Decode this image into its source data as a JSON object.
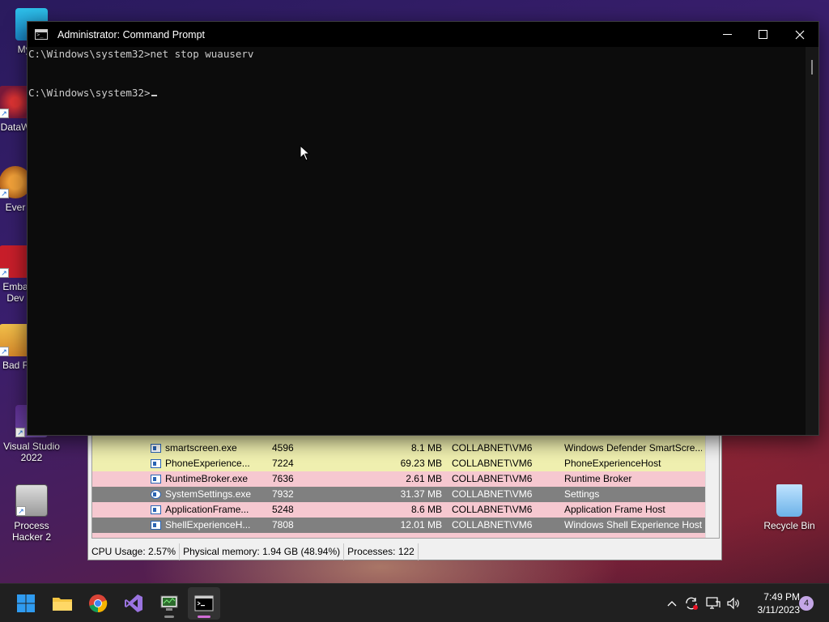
{
  "desktop": {
    "icons": [
      {
        "label": "My Co",
        "name": "my-computer"
      },
      {
        "label": "DataW",
        "name": "datawizard"
      },
      {
        "label": "Ever",
        "name": "everything"
      },
      {
        "label": "Emba\nDev",
        "name": "embarcadero-dev"
      },
      {
        "label": "Bad F",
        "name": "bad-piggies"
      },
      {
        "label": "Visual Studio\n2022",
        "name": "visual-studio-2022"
      },
      {
        "label": "Process\nHacker 2",
        "name": "process-hacker-2"
      },
      {
        "label": "Recycle Bin",
        "name": "recycle-bin"
      }
    ]
  },
  "cmd": {
    "title": "Administrator: Command Prompt",
    "lines": [
      "C:\\Windows\\system32>net stop wuauserv",
      "",
      "C:\\Windows\\system32>"
    ]
  },
  "process_hacker": {
    "rows": [
      {
        "name": "smartscreen.exe",
        "pid": "4596",
        "mem": "8.1 MB",
        "user": "COLLABNET\\VM6",
        "desc": "Windows Defender SmartScre...",
        "color": "#f0f0b0"
      },
      {
        "name": "PhoneExperience...",
        "pid": "7224",
        "mem": "69.23 MB",
        "user": "COLLABNET\\VM6",
        "desc": "PhoneExperienceHost",
        "color": "#f0f0b0"
      },
      {
        "name": "RuntimeBroker.exe",
        "pid": "7636",
        "mem": "2.61 MB",
        "user": "COLLABNET\\VM6",
        "desc": "Runtime Broker",
        "color": "#f6c8d0"
      },
      {
        "name": "SystemSettings.exe",
        "pid": "7932",
        "mem": "31.37 MB",
        "user": "COLLABNET\\VM6",
        "desc": "Settings",
        "color": "#808080"
      },
      {
        "name": "ApplicationFrame...",
        "pid": "5248",
        "mem": "8.6 MB",
        "user": "COLLABNET\\VM6",
        "desc": "Application Frame Host",
        "color": "#f6c8d0"
      },
      {
        "name": "ShellExperienceH...",
        "pid": "7808",
        "mem": "12.01 MB",
        "user": "COLLABNET\\VM6",
        "desc": "Windows Shell Experience Host",
        "color": "#808080"
      }
    ],
    "status": {
      "cpu": "CPU Usage: 2.57%",
      "memory": "Physical memory: 1.94 GB (48.94%)",
      "processes": "Processes: 122"
    }
  },
  "taskbar": {
    "clock_time": "7:49 PM",
    "clock_date": "3/11/2023",
    "notification_count": "4"
  },
  "colors": {
    "cmd_bg": "#0c0c0c",
    "cmd_text": "#cccccc",
    "taskbar_bg": "#202020",
    "accent": "#d16cd6"
  }
}
